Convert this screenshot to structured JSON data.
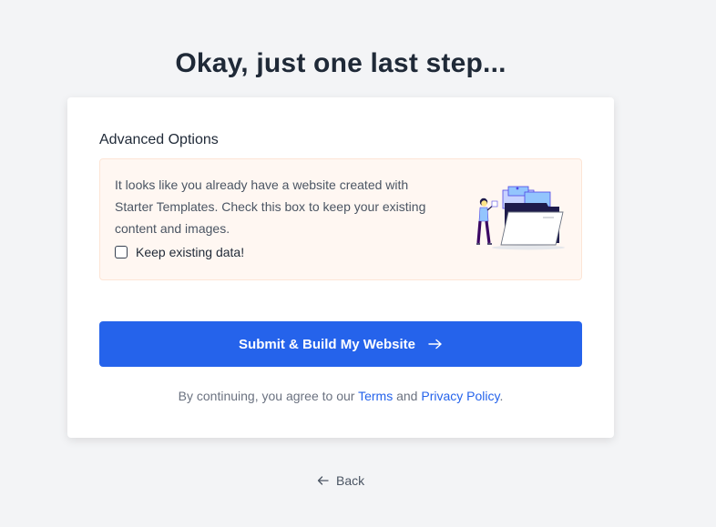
{
  "page": {
    "title": "Okay, just one last step..."
  },
  "advanced_options": {
    "heading": "Advanced Options",
    "notice_text": "It looks like you already have a website created with Starter Templates. Check this box to keep your existing content and images.",
    "keep_data_label": "Keep existing data!",
    "keep_data_checked": false,
    "illustration_icon": "folder-documents-person-illustration"
  },
  "submit": {
    "label": "Submit & Build My Website",
    "icon": "arrow-right-icon"
  },
  "consent": {
    "prefix": "By continuing, you agree to our",
    "terms_label": "Terms",
    "and_text": "and",
    "privacy_label": "Privacy Policy",
    "suffix": "."
  },
  "navigation": {
    "back_label": "Back",
    "back_icon": "arrow-left-icon"
  },
  "colors": {
    "primary": "#2563eb",
    "background": "#f3f4f6",
    "notice_background": "#fff7f2",
    "notice_border": "#fde5d6",
    "text_dark": "#1f2937",
    "text_muted": "#6b7280"
  }
}
